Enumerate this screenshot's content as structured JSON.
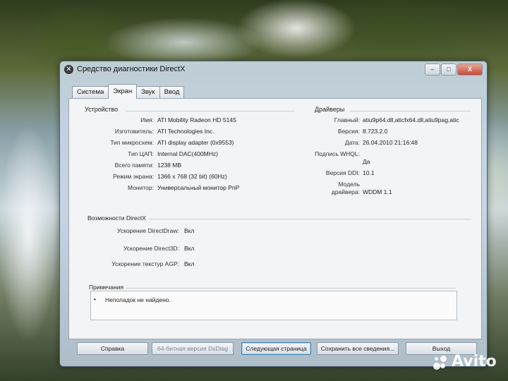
{
  "window": {
    "title": "Средство диагностики DirectX",
    "icon": "directx-x-icon",
    "controls": {
      "minimize": "–",
      "maximize": "□",
      "close": "X"
    }
  },
  "tabs": [
    {
      "label": "Система",
      "active": false
    },
    {
      "label": "Экран",
      "active": true
    },
    {
      "label": "Звук",
      "active": false
    },
    {
      "label": "Ввод",
      "active": false
    }
  ],
  "device": {
    "heading": "Устройство",
    "rows": [
      {
        "label": "Имя:",
        "value": "ATI Mobility Radeon HD 5145"
      },
      {
        "label": "Изготовитель:",
        "value": "ATI Technologies Inc."
      },
      {
        "label": "Тип микросхем:",
        "value": "ATI display adapter (0x9553)"
      },
      {
        "label": "Тип ЦАП:",
        "value": "Internal DAC(400MHz)"
      },
      {
        "label": "Всего памяти:",
        "value": "1238 MB"
      },
      {
        "label": "Режим экрана:",
        "value": "1366 x 768 (32 bit) (60Hz)"
      },
      {
        "label": "Монитор:",
        "value": "Универсальный монитор PnP"
      }
    ]
  },
  "drivers": {
    "heading": "Драйверы",
    "rows": [
      {
        "label": "Главный:",
        "value": "atiu9p64.dll,aticfx64.dll,atiu9pag,atic"
      },
      {
        "label": "Версия:",
        "value": "8.723.2.0"
      },
      {
        "label": "Дата:",
        "value": "26.04.2010 21:16:48"
      },
      {
        "label": "Подпись WHQL:",
        "value": "Да"
      },
      {
        "label": "Версия DDI:",
        "value": "10.1"
      },
      {
        "label_line1": "Модель",
        "label": "драйвера:",
        "value": "WDDM 1.1"
      }
    ]
  },
  "features": {
    "heading": "Возможности DirectX",
    "rows": [
      {
        "label": "Ускорение DirectDraw:",
        "value": "Вкл"
      },
      {
        "label": "Ускорение Direct3D:",
        "value": "Вкл"
      },
      {
        "label": "Ускорение текстур AGP:",
        "value": "Вкл"
      }
    ]
  },
  "notes": {
    "heading": "Примечания",
    "bullet": "•",
    "text": "Неполадок не найдено."
  },
  "buttons": {
    "help": "Справка",
    "dxdiag64": "64-битная версия DxDiag",
    "next": "Следующая страница",
    "save": "Сохранить все сведения...",
    "exit": "Выход"
  },
  "watermark": {
    "text": "Avito"
  }
}
